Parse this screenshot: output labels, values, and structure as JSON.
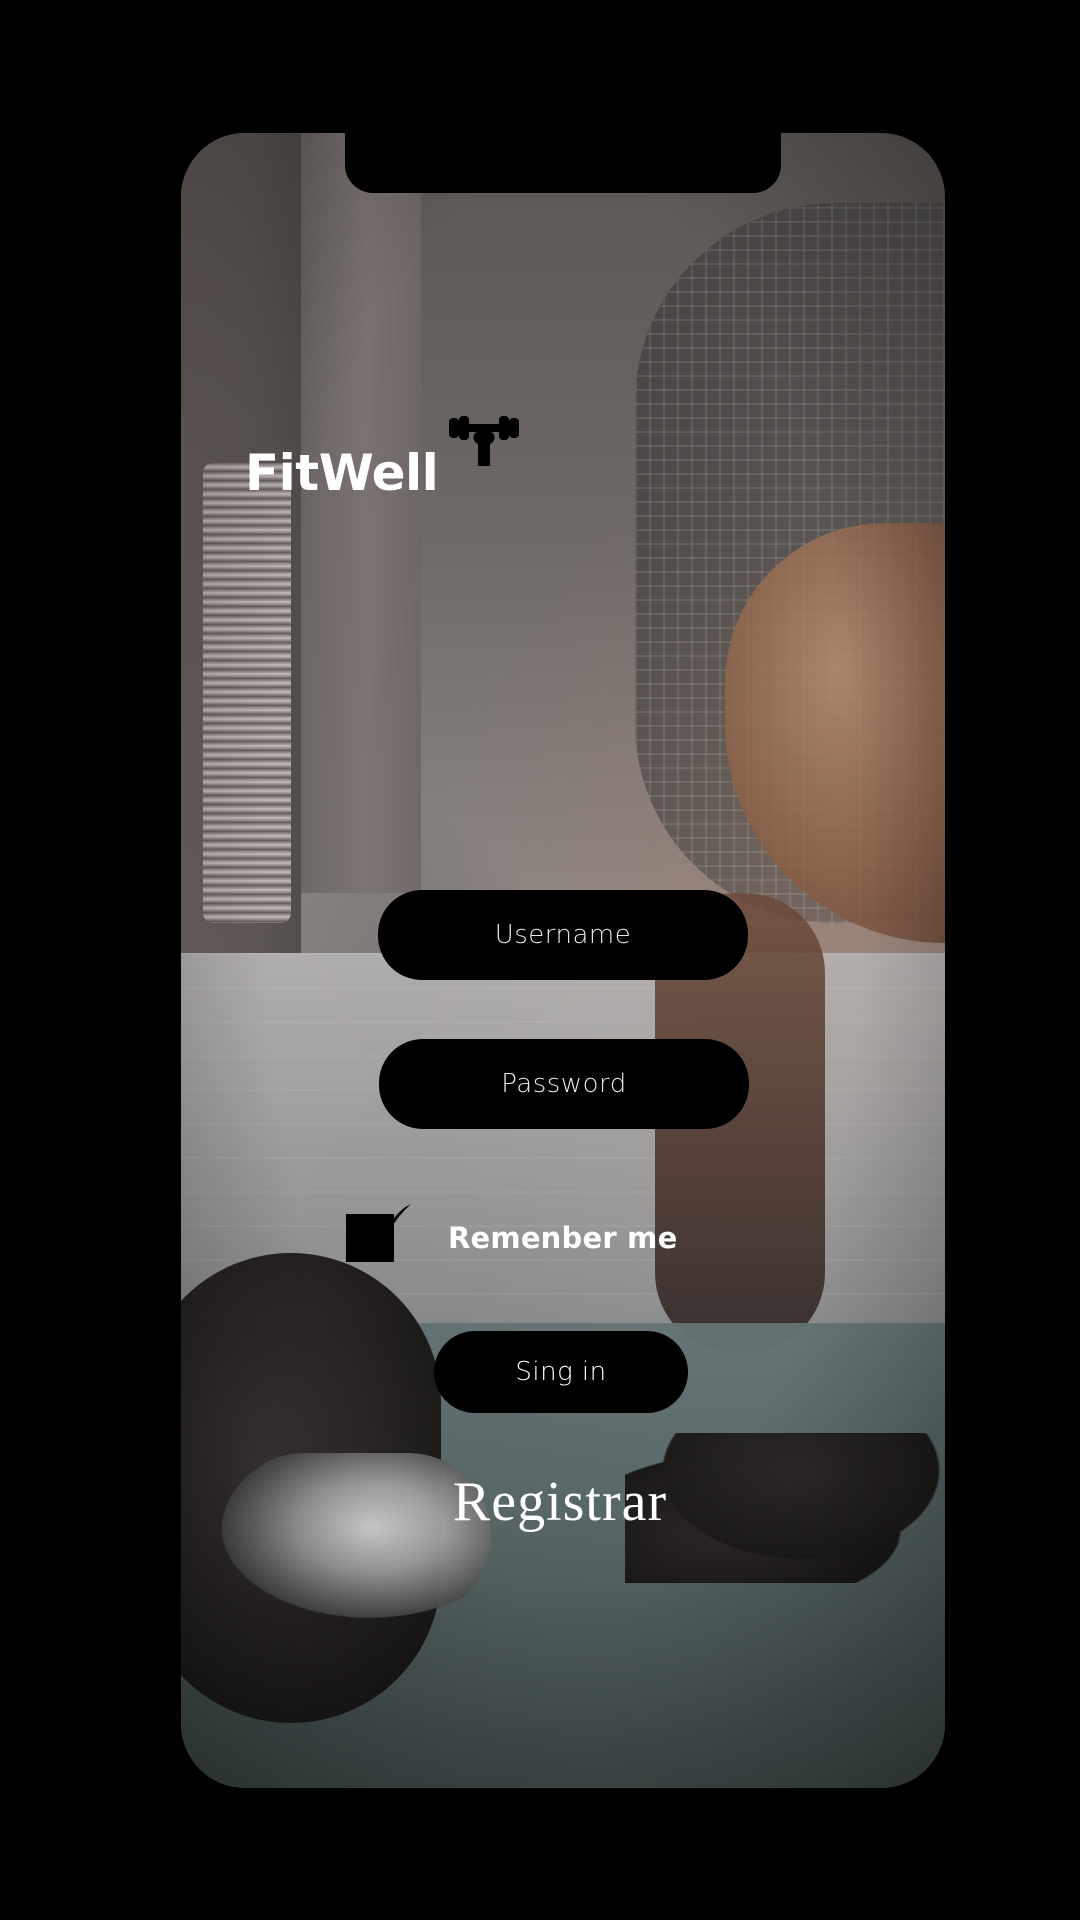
{
  "app": {
    "brand_name": "FitWell",
    "brand_icon": "dumbbell-icon"
  },
  "login": {
    "username": {
      "placeholder": "Username",
      "value": ""
    },
    "password": {
      "placeholder": "Password",
      "value": ""
    },
    "remember_me": {
      "label": "Remenber me",
      "checked": true,
      "icon": "checkmark-icon"
    },
    "signin_label": "Sing in",
    "register_label": "Registrar"
  },
  "colors": {
    "background": "#000000",
    "pill_background": "#000000",
    "text_primary": "#ffffff"
  }
}
